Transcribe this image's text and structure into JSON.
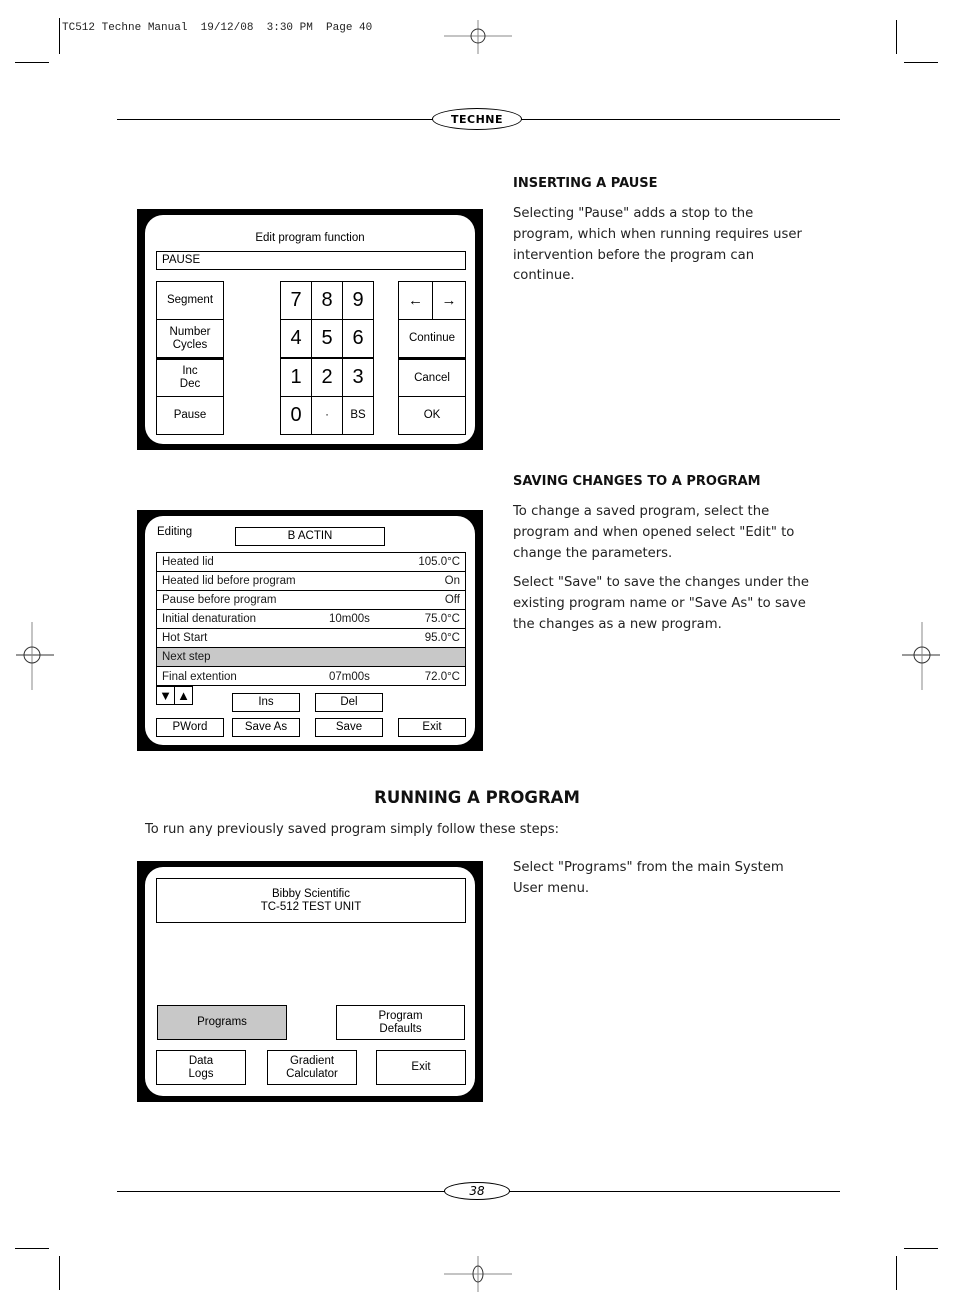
{
  "print_slug": "TC512 Techne Manual  19/12/08  3:30 PM  Page 40",
  "logo_text": "TECHNE",
  "sections": {
    "pause": {
      "heading": "INSERTING A PAUSE",
      "paragraphs": [
        "Selecting \"Pause\" adds a stop to the program, which when running requires user intervention before the program can continue."
      ]
    },
    "saving": {
      "heading": "SAVING CHANGES TO A PROGRAM",
      "paragraphs": [
        "To change a saved program, select the program and when opened select \"Edit\" to change the parameters.",
        "Select \"Save\" to save the changes under the existing program name or \"Save As\" to save the changes as a new program."
      ]
    },
    "running": {
      "heading": "RUNNING A PROGRAM",
      "intro": "To run any previously saved program simply follow these steps:",
      "step_text": "Select \"Programs\" from the main System User menu."
    }
  },
  "screen_edit_function": {
    "title": "Edit program function",
    "input_value": "PAUSE",
    "left_buttons": [
      "Segment",
      "Number\nCycles",
      "Inc\nDec",
      "Pause"
    ],
    "keypad": [
      "7",
      "8",
      "9",
      "4",
      "5",
      "6",
      "1",
      "2",
      "3",
      "0",
      "·",
      "BS"
    ],
    "arrow_left": "←",
    "arrow_right": "→",
    "right_buttons": [
      "Continue",
      "Cancel",
      "OK"
    ]
  },
  "screen_editing": {
    "label": "Editing",
    "program_name": "B ACTIN",
    "rows": [
      {
        "label": "Heated lid",
        "mid": "",
        "value": "105.0°C"
      },
      {
        "label": "Heated lid before program",
        "mid": "",
        "value": "On"
      },
      {
        "label": "Pause before program",
        "mid": "",
        "value": "Off"
      },
      {
        "label": "Initial denaturation",
        "mid": "10m00s",
        "value": "75.0°C"
      },
      {
        "label": "Hot Start",
        "mid": "",
        "value": "95.0°C"
      },
      {
        "label": "Next step",
        "mid": "",
        "value": "",
        "selected": true
      },
      {
        "label": "Final extention",
        "mid": "07m00s",
        "value": "72.0°C"
      }
    ],
    "scroll_down": "▼",
    "scroll_up": "▲",
    "ins_label": "Ins",
    "del_label": "Del",
    "pword_label": "PWord",
    "save_as_label": "Save As",
    "save_label": "Save",
    "exit_label": "Exit"
  },
  "screen_main_menu": {
    "banner_line1": "Bibby Scientific",
    "banner_line2": "TC-512 TEST UNIT",
    "programs_label": "Programs",
    "program_defaults_label": "Program\nDefaults",
    "data_logs_label": "Data\nLogs",
    "gradient_calc_label": "Gradient\nCalculator",
    "exit_label": "Exit"
  },
  "page_number": "38"
}
